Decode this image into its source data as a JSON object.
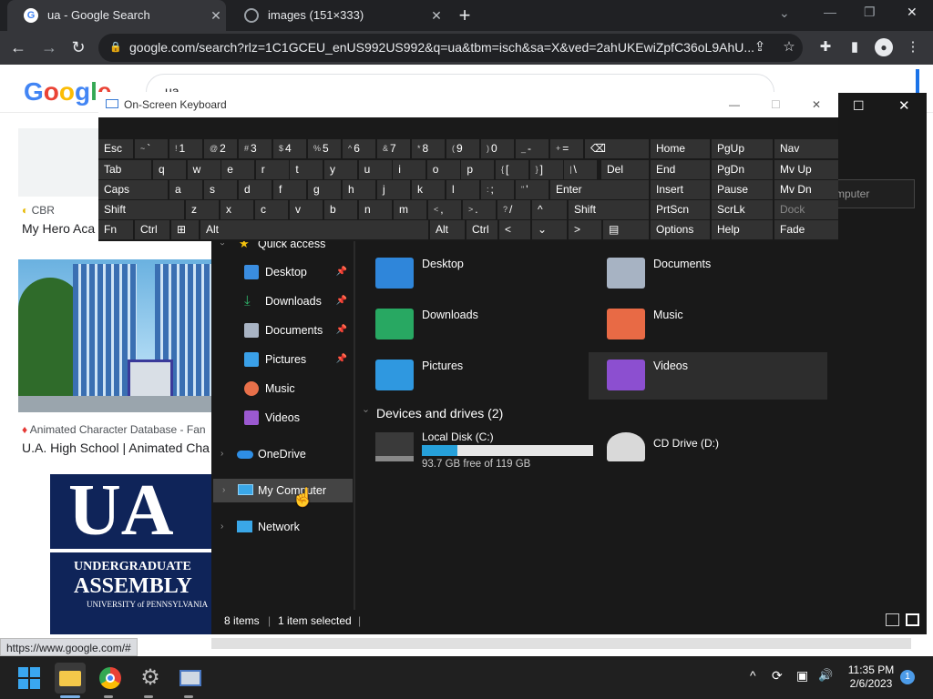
{
  "chrome": {
    "tabs": [
      {
        "title": "ua - Google Search",
        "close": "✕"
      },
      {
        "title": "images (151×333)",
        "close": "✕"
      }
    ],
    "new_tab": "+",
    "window_controls": [
      "⌄",
      "—",
      "❐",
      "✕"
    ],
    "url": "google.com/search?rlz=1C1GCEU_enUS992US992&q=ua&tbm=isch&sa=X&ved=2ahUKEwiZpfC36oL9AhU...",
    "nav": {
      "back": "←",
      "forward": "→",
      "reload": "↻"
    }
  },
  "google": {
    "logo": [
      "G",
      "o",
      "o",
      "g",
      "l",
      "e"
    ],
    "logo_colors": [
      "#4285f4",
      "#ea4335",
      "#fbbc05",
      "#4285f4",
      "#34a853",
      "#ea4335"
    ],
    "search_value": "ua",
    "results": [
      {
        "source": "CBR",
        "title": "My Hero Aca"
      },
      {
        "source": "Animated Character Database - Fan",
        "title": "U.A. High School | Animated Cha"
      }
    ],
    "ua_logo": {
      "big": "UA",
      "line1": "UNDERGRADUATE",
      "line2": "ASSEMBLY",
      "line3": "UNIVERSITY of PENNSYLVANIA"
    },
    "status_url": "https://www.google.com/#"
  },
  "osk": {
    "title": "On-Screen Keyboard",
    "controls": [
      "—",
      "☐",
      "✕"
    ],
    "rows": [
      [
        {
          "s": "~",
          "m": "`"
        },
        {
          "s": "!",
          "m": "1"
        },
        {
          "s": "@",
          "m": "2"
        },
        {
          "s": "#",
          "m": "3"
        },
        {
          "s": "$",
          "m": "4"
        },
        {
          "s": "%",
          "m": "5"
        },
        {
          "s": "^",
          "m": "6"
        },
        {
          "s": "&",
          "m": "7"
        },
        {
          "s": "*",
          "m": "8"
        },
        {
          "s": "(",
          "m": "9"
        },
        {
          "s": ")",
          "m": "0"
        },
        {
          "s": "_",
          "m": "-"
        },
        {
          "s": "+",
          "m": "="
        }
      ],
      [
        "q",
        "w",
        "e",
        "r",
        "t",
        "y",
        "u",
        "i",
        "o",
        "p",
        {
          "s": "{",
          "m": "["
        },
        {
          "s": "}",
          "m": "]"
        },
        {
          "s": "|",
          "m": "\\"
        }
      ],
      [
        "a",
        "s",
        "d",
        "f",
        "g",
        "h",
        "j",
        "k",
        "l",
        {
          "s": ":",
          "m": ";"
        },
        {
          "s": "\"",
          "m": "'"
        }
      ],
      [
        "z",
        "x",
        "c",
        "v",
        "b",
        "n",
        "m",
        {
          "s": "<",
          "m": ","
        },
        {
          "s": ">",
          "m": "."
        },
        {
          "s": "?",
          "m": "/"
        }
      ]
    ],
    "labels": {
      "esc": "Esc",
      "tab": "Tab",
      "caps": "Caps",
      "shift": "Shift",
      "fn": "Fn",
      "ctrl": "Ctrl",
      "alt": "Alt",
      "del": "Del",
      "enter": "Enter",
      "bksp": "⌫",
      "up": "^",
      "down": "⌄",
      "left": "<",
      "right": ">",
      "menu": "▤"
    },
    "side": [
      [
        "Home",
        "PgUp",
        "Nav"
      ],
      [
        "End",
        "PgDn",
        "Mv Up"
      ],
      [
        "Insert",
        "Pause",
        "Mv Dn"
      ],
      [
        "PrtScn",
        "ScrLk",
        "Dock"
      ],
      [
        "Options",
        "Help",
        "Fade"
      ]
    ]
  },
  "explorer": {
    "controls": [
      "☐",
      "✕"
    ],
    "search_placeholder": "mputer",
    "nav": {
      "quick_access": "Quick access",
      "items": [
        {
          "label": "Desktop",
          "color": "#3a8de0",
          "pin": "📌"
        },
        {
          "label": "Downloads",
          "color": "#2fb56a",
          "pin": "📌"
        },
        {
          "label": "Documents",
          "color": "#a9b4c4",
          "pin": "📌"
        },
        {
          "label": "Pictures",
          "color": "#3aa0e8",
          "pin": "📌"
        },
        {
          "label": "Music",
          "color": "#e8704a"
        },
        {
          "label": "Videos",
          "color": "#9b59d0"
        }
      ],
      "onedrive": "OneDrive",
      "my_computer": "My Computer",
      "network": "Network",
      "chevron": "›"
    },
    "folders": [
      {
        "label": "Desktop",
        "color": "#2f86da"
      },
      {
        "label": "Documents",
        "color": "#a7b3c3"
      },
      {
        "label": "Downloads",
        "color": "#28a862"
      },
      {
        "label": "Music",
        "color": "#e86a45"
      },
      {
        "label": "Pictures",
        "color": "#2f98e0"
      },
      {
        "label": "Videos",
        "color": "#8c4fd0"
      }
    ],
    "drives_header": "Devices and drives (2)",
    "drives": [
      {
        "label": "Local Disk (C:)",
        "free": "93.7 GB free of 119 GB",
        "used_fraction": 0.21
      },
      {
        "label": "CD Drive (D:)"
      }
    ],
    "status": {
      "items": "8 items",
      "selected": "1 item selected"
    }
  },
  "taskbar": {
    "time": "11:35 PM",
    "date": "2/6/2023",
    "notifications": "1",
    "tray": [
      "^",
      "⟳",
      "▣",
      "🔊"
    ]
  }
}
